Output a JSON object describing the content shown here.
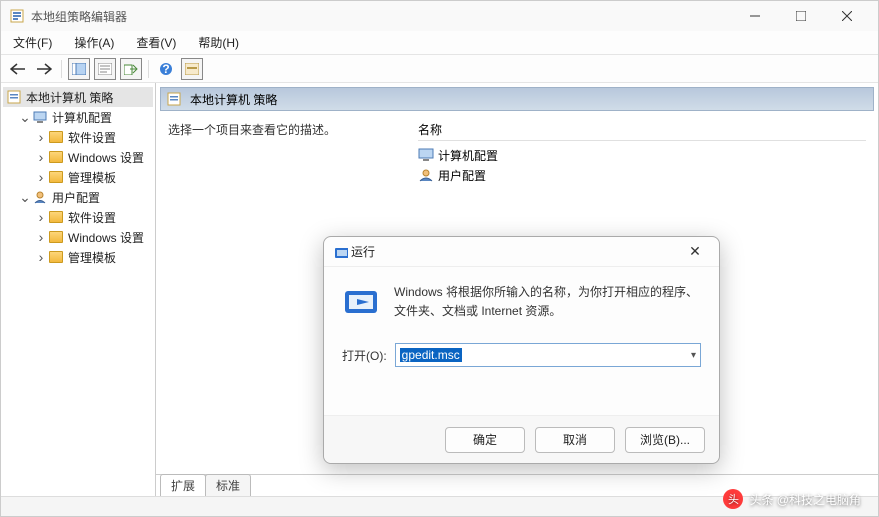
{
  "window": {
    "title": "本地组策略编辑器"
  },
  "menu": {
    "file": "文件(F)",
    "action": "操作(A)",
    "view": "查看(V)",
    "help": "帮助(H)"
  },
  "tree": {
    "root": "本地计算机 策略",
    "computer": "计算机配置",
    "user": "用户配置",
    "software": "软件设置",
    "windows": "Windows 设置",
    "admin": "管理模板"
  },
  "main": {
    "header": "本地计算机 策略",
    "description": "选择一个项目来查看它的描述。",
    "col_name": "名称",
    "items": {
      "computer": "计算机配置",
      "user": "用户配置"
    }
  },
  "tabs": {
    "extended": "扩展",
    "standard": "标准"
  },
  "run_dialog": {
    "title": "运行",
    "description": "Windows 将根据你所输入的名称，为你打开相应的程序、文件夹、文档或 Internet 资源。",
    "open_label": "打开(O):",
    "value": "gpedit.msc",
    "ok": "确定",
    "cancel": "取消",
    "browse": "浏览(B)..."
  },
  "watermark": "头条 @科技之电脑角"
}
